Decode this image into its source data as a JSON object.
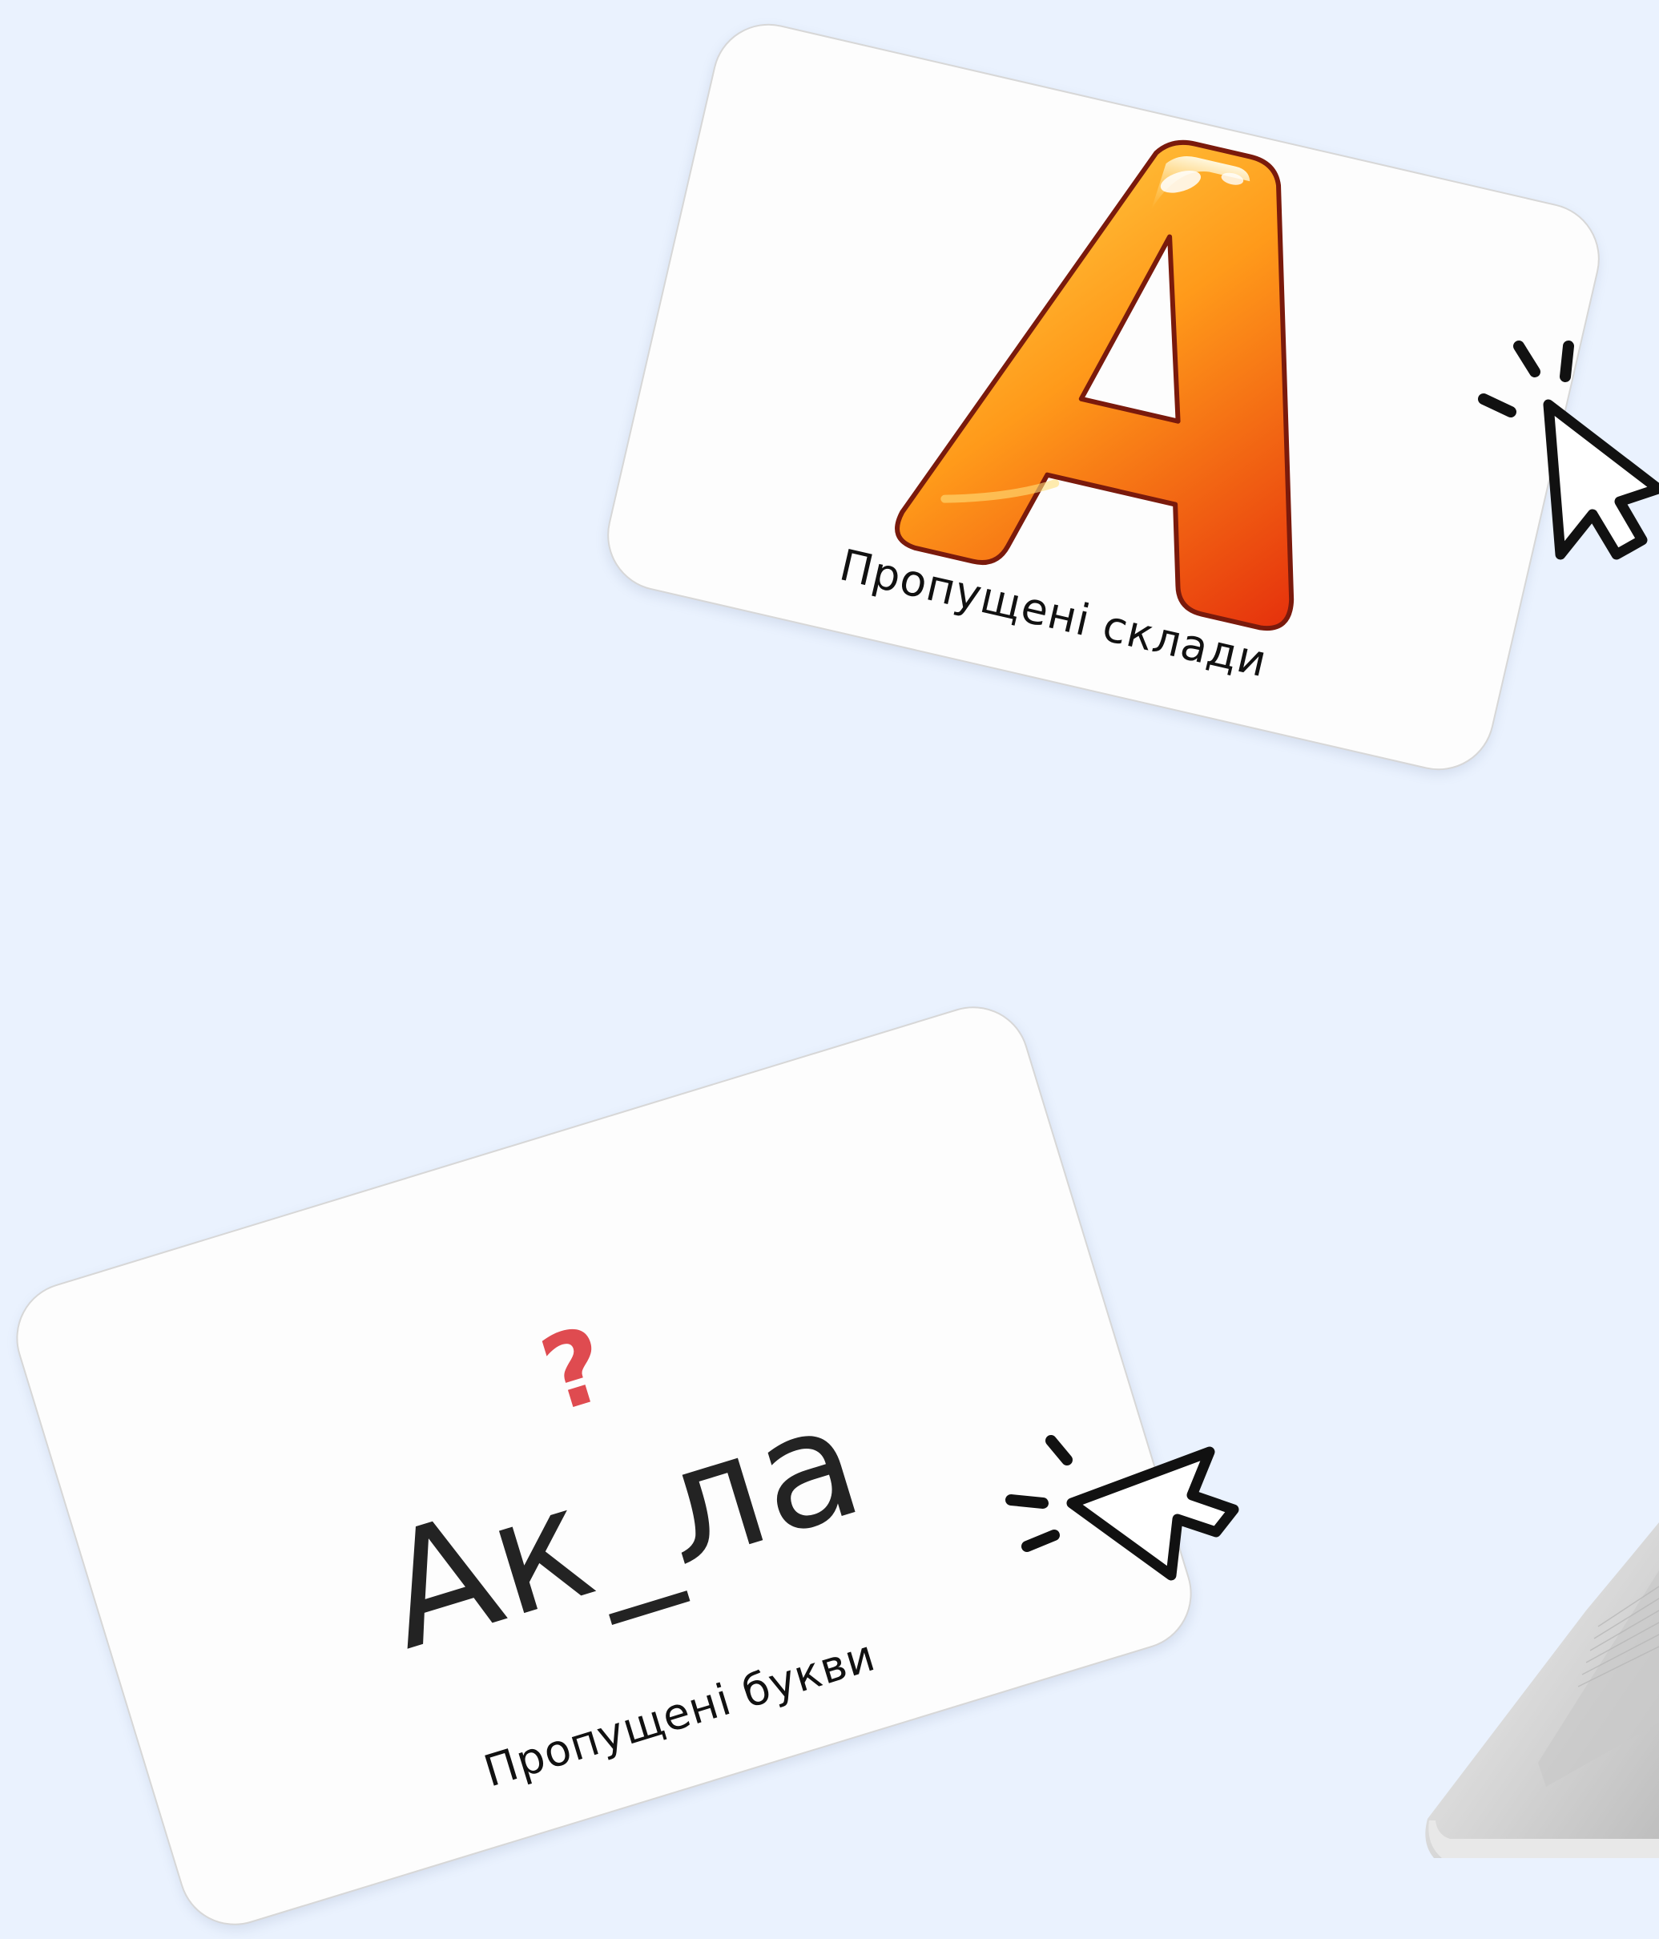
{
  "cards": {
    "syllables": {
      "caption": "Пропущені склади",
      "image_icon": "orange-letter-a-icon"
    },
    "letters": {
      "caption": "Пропущені букви",
      "question": "?",
      "word": "Ак_ла"
    }
  },
  "cursors": {
    "top": "click-cursor-icon",
    "bottom": "click-cursor-icon"
  },
  "decor": {
    "laptop": "laptop-corner-image"
  },
  "colors": {
    "background": "#eaf2fe",
    "card": "#fdfdfd",
    "question_mark": "#df4b50",
    "letter_a_light": "#ffc43a",
    "letter_a_dark": "#e8350c"
  }
}
